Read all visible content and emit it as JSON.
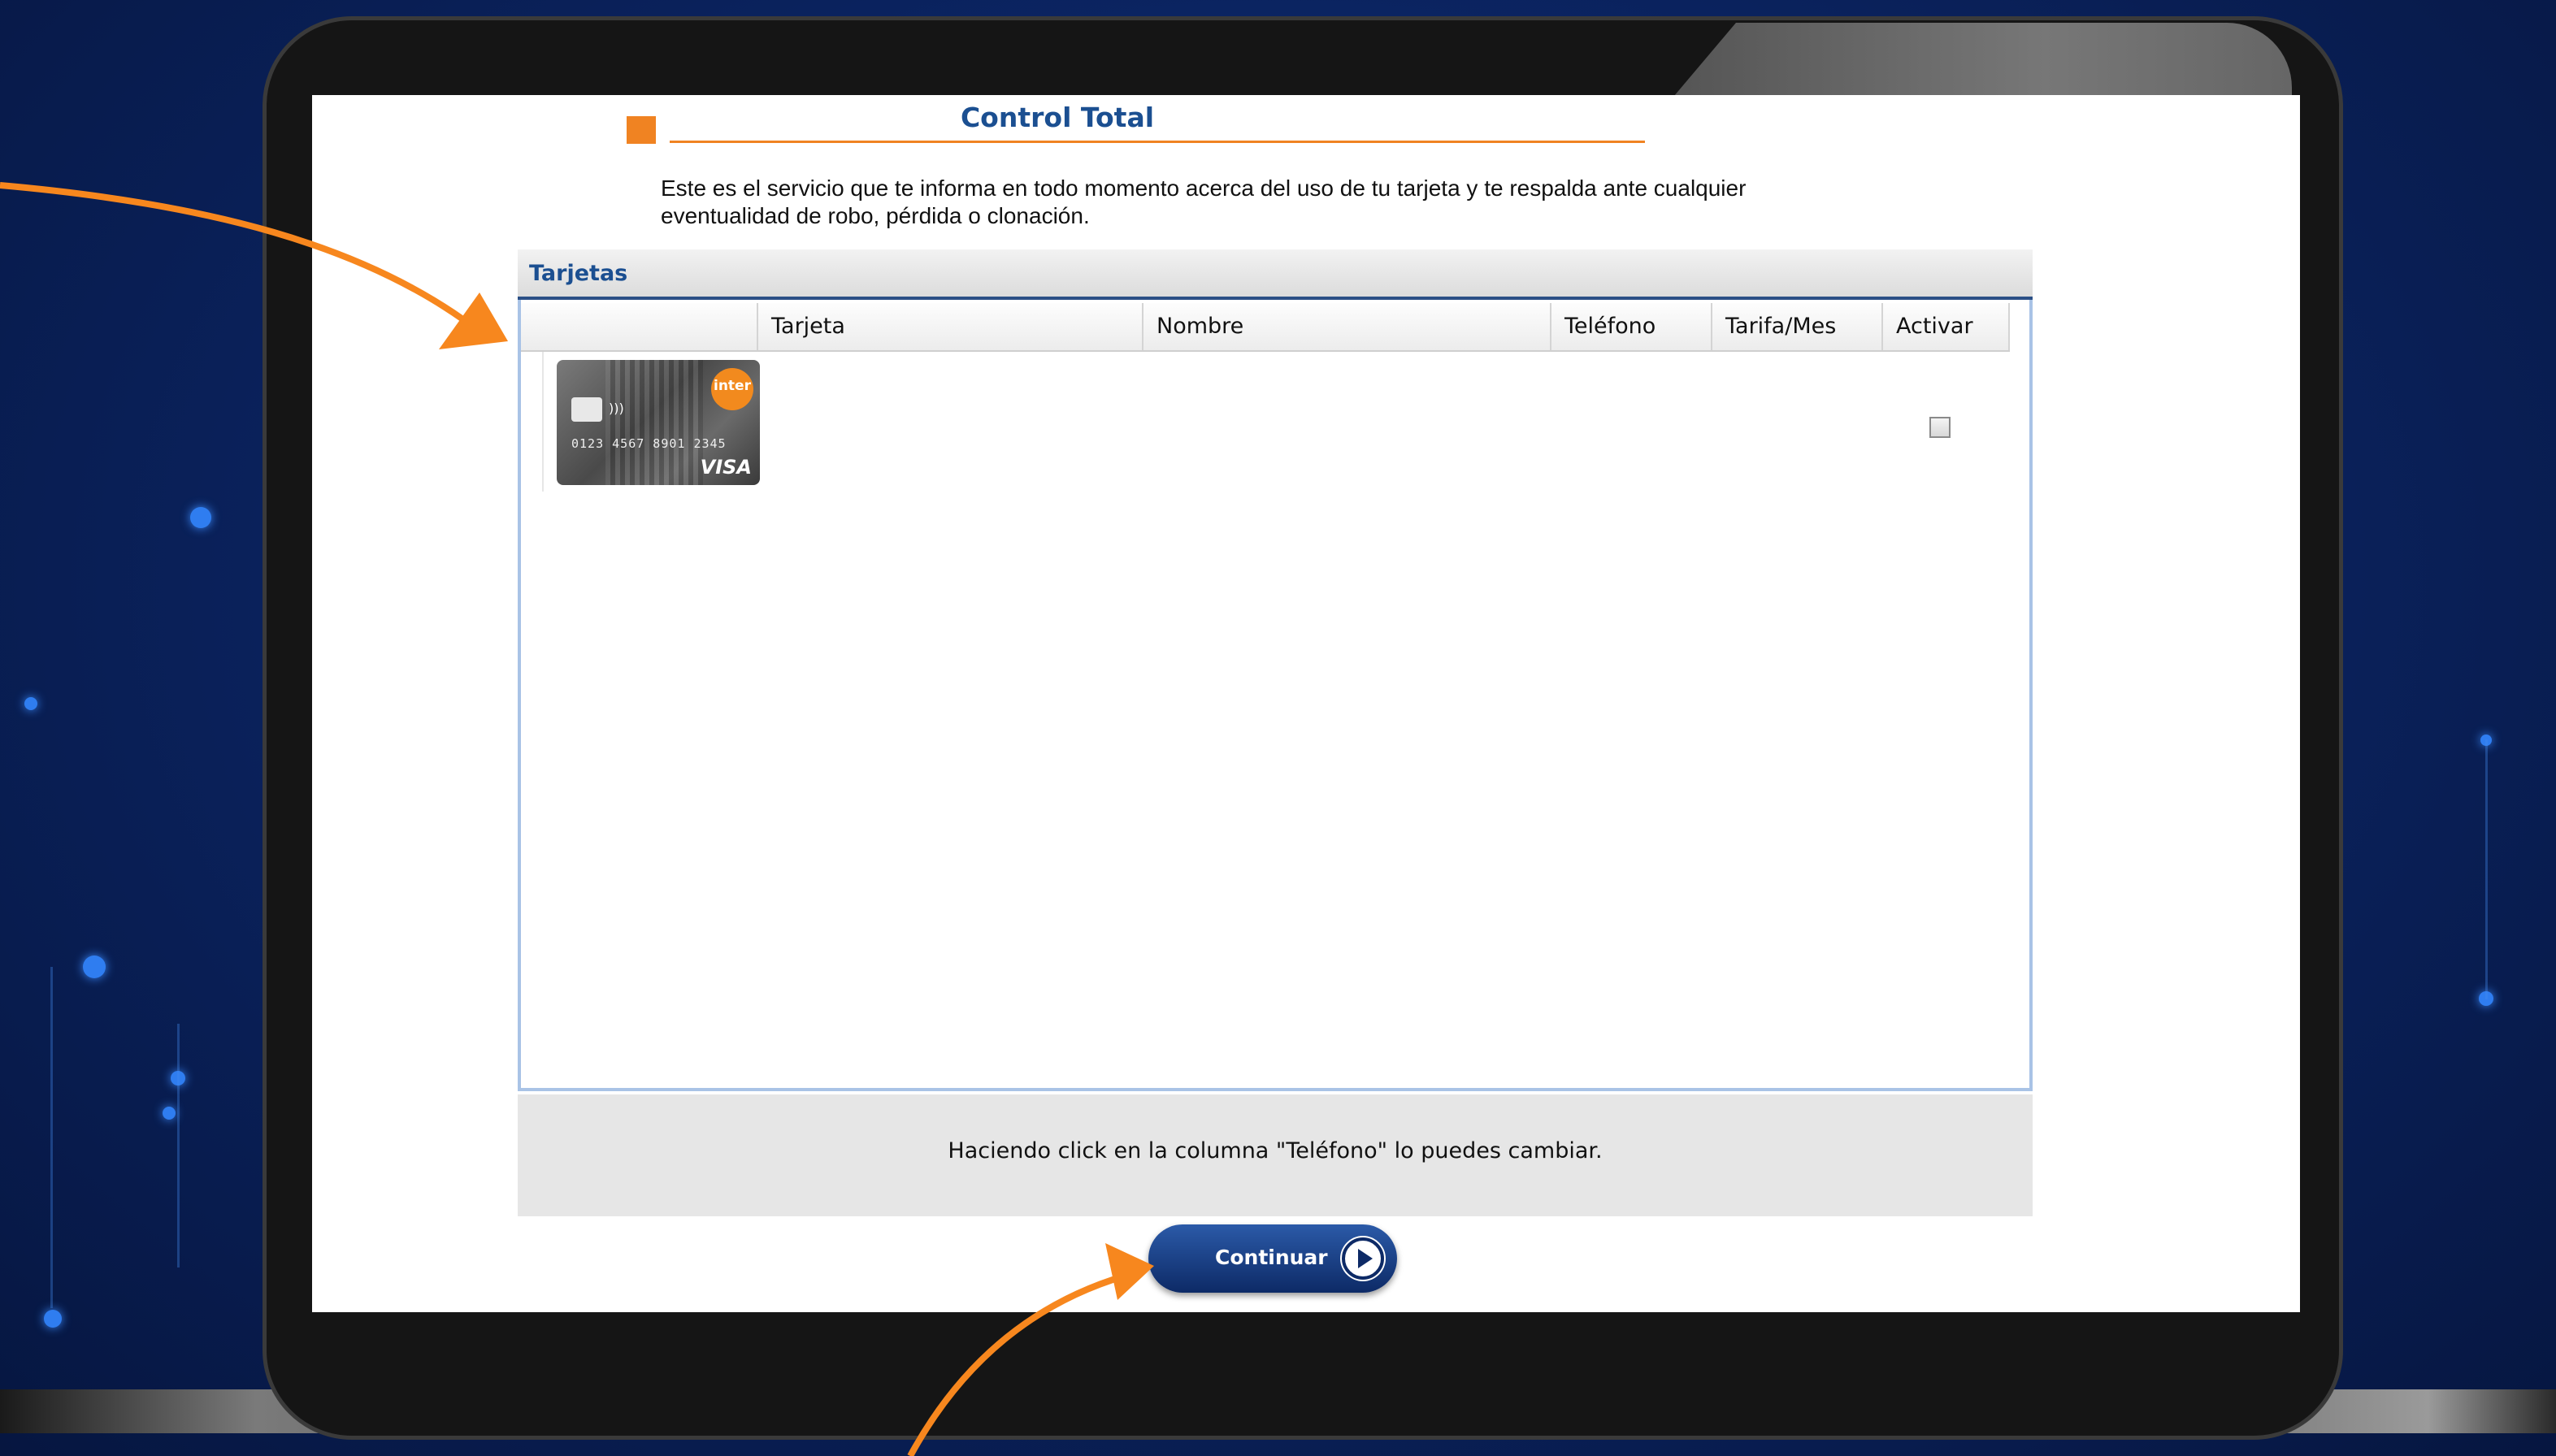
{
  "page": {
    "title": "Control Total",
    "intro_line1": "Este es el servicio que te informa en todo momento acerca del uso de tu tarjeta y te respalda ante cualquier",
    "intro_line2": "eventualidad de robo, pérdida o clonación."
  },
  "panel": {
    "title": "Tarjetas",
    "columns": [
      "Tarjeta",
      "Nombre",
      "Teléfono",
      "Tarifa/Mes",
      "Activar"
    ],
    "rows": [
      {
        "card": {
          "brand_logo": "inter",
          "number": "0123 4567 8901 2345",
          "network": "VISA"
        },
        "tarjeta": "",
        "nombre": "",
        "telefono": "",
        "tarifa": "",
        "activar_checked": false
      }
    ]
  },
  "footer": {
    "note": "Haciendo click en la columna \"Teléfono\" lo puedes cambiar."
  },
  "actions": {
    "continue_label": "Continuar",
    "continue_icon": "play-circle-icon"
  },
  "colors": {
    "accent_orange": "#f08322",
    "title_blue": "#1b4f91",
    "button_blue": "#0d2a66"
  }
}
